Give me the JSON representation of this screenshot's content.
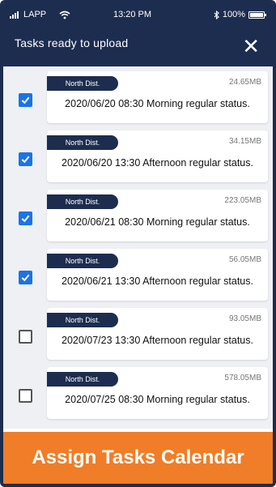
{
  "statusbar": {
    "carrier": "LAPP",
    "time": "13:20 PM",
    "battery": "100%"
  },
  "header": {
    "title": "Tasks ready to upload",
    "close_glyph": "✕"
  },
  "tasks": [
    {
      "badge": "North Dist.",
      "size": "24.65MB",
      "description": "2020/06/20 08:30 Morning regular status.",
      "checked": true
    },
    {
      "badge": "North Dist.",
      "size": "34.15MB",
      "description": "2020/06/20 13:30 Afternoon regular status.",
      "checked": true
    },
    {
      "badge": "North Dist.",
      "size": "223.05MB",
      "description": "2020/06/21 08:30 Morning regular status.",
      "checked": true
    },
    {
      "badge": "North Dist.",
      "size": "56.05MB",
      "description": "2020/06/21 13:30 Afternoon regular status.",
      "checked": true
    },
    {
      "badge": "North Dist.",
      "size": "93.05MB",
      "description": "2020/07/23 13:30 Afternoon regular status.",
      "checked": false
    },
    {
      "badge": "North Dist.",
      "size": "578.05MB",
      "description": "2020/07/25 08:30 Morning regular status.",
      "checked": false
    }
  ],
  "banner": {
    "label": "Assign Tasks Calendar"
  },
  "colors": {
    "navy": "#1d2d4f",
    "checkbox_blue": "#1a73e8",
    "banner_orange": "#f07d28"
  }
}
